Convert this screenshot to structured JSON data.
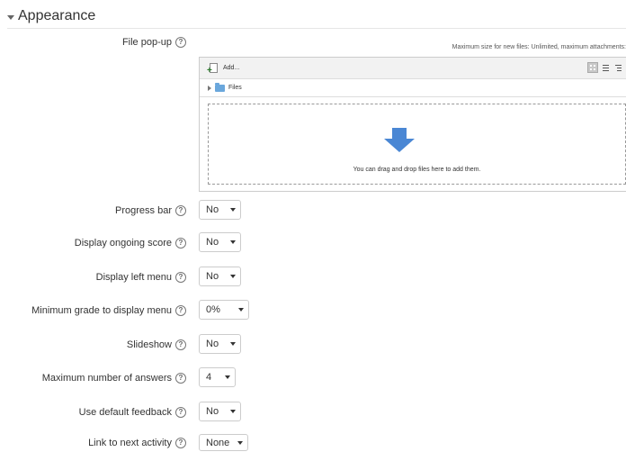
{
  "section": {
    "title": "Appearance"
  },
  "file_popup": {
    "label": "File pop-up",
    "max_note": "Maximum size for new files: Unlimited, maximum attachments:",
    "add_label": "Add...",
    "path_label": "Files",
    "drop_text": "You can drag and drop files here to add them."
  },
  "fields": [
    {
      "label": "Progress bar",
      "value": "No"
    },
    {
      "label": "Display ongoing score",
      "value": "No"
    },
    {
      "label": "Display left menu",
      "value": "No"
    },
    {
      "label": "Minimum grade to display menu",
      "value": "0%"
    },
    {
      "label": "Slideshow",
      "value": "No"
    },
    {
      "label": "Maximum number of answers",
      "value": "4"
    },
    {
      "label": "Use default feedback",
      "value": "No"
    },
    {
      "label": "Link to next activity",
      "value": "None"
    }
  ],
  "colors": {
    "drop_arrow": "#4a87d4",
    "folder": "#6aa7dc"
  }
}
